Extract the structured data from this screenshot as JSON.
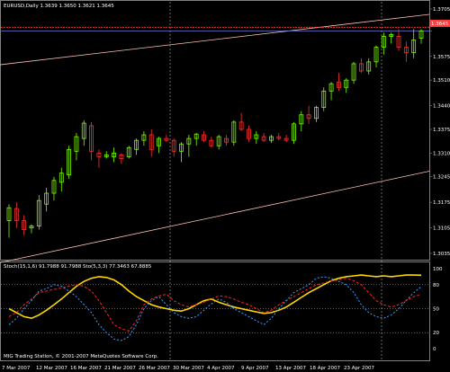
{
  "main_header": "EURUSD,Daily  1.3639 1.3650 1.3621 1.3645",
  "stoch_header": "Stoch(15,1,6) 91.7988 91.7988  Sto(5,3,3) 77.3463 67.8885",
  "copyright": "MIG Trading Station, © 2001-2007 MetaQuotes Software Corp.",
  "price_badge": "1.3645",
  "price_ticks": [
    "1.3705",
    "1.3645",
    "1.3575",
    "1.3510",
    "1.3440",
    "1.3375",
    "1.3310",
    "1.3245",
    "1.3175",
    "1.3105",
    "1.3035"
  ],
  "stoch_ticks": [
    "100",
    "80",
    "50",
    "20",
    "0"
  ],
  "date_labels": [
    "7 Mar 2007",
    "12 Mar 2007",
    "16 Mar 2007",
    "21 Mar 2007",
    "26 Mar 2007",
    "30 Mar 2007",
    "4 Apr 2007",
    "9 Apr 2007",
    "13 Apr 2007",
    "18 Apr 2007",
    "23 Apr 2007"
  ],
  "colors": {
    "background": "#000000",
    "bull": "#7cfc00",
    "bear": "#ff3030",
    "stoch_main": "#ffd700",
    "sto_signal": "#ff2222",
    "sto_main": "#3aa0ff",
    "trendline": "#ffc0b4",
    "price_badge": "#ff3b3b"
  },
  "chart_data": [
    {
      "type": "candlestick",
      "series": [
        {
          "name": "EURUSD,Daily"
        }
      ],
      "ylim": [
        1.3035,
        1.3705
      ],
      "candles": [
        {
          "o": 1.3125,
          "h": 1.317,
          "l": 1.3078,
          "c": 1.316
        },
        {
          "o": 1.3158,
          "h": 1.3175,
          "l": 1.3105,
          "c": 1.3125
        },
        {
          "o": 1.3125,
          "h": 1.314,
          "l": 1.3085,
          "c": 1.31
        },
        {
          "o": 1.3105,
          "h": 1.3115,
          "l": 1.309,
          "c": 1.311
        },
        {
          "o": 1.311,
          "h": 1.3195,
          "l": 1.31,
          "c": 1.318
        },
        {
          "o": 1.317,
          "h": 1.3215,
          "l": 1.315,
          "c": 1.32
        },
        {
          "o": 1.32,
          "h": 1.3245,
          "l": 1.318,
          "c": 1.3235
        },
        {
          "o": 1.323,
          "h": 1.327,
          "l": 1.3205,
          "c": 1.3255
        },
        {
          "o": 1.325,
          "h": 1.333,
          "l": 1.324,
          "c": 1.332
        },
        {
          "o": 1.3315,
          "h": 1.3365,
          "l": 1.329,
          "c": 1.3355
        },
        {
          "o": 1.335,
          "h": 1.34,
          "l": 1.333,
          "c": 1.3392
        },
        {
          "o": 1.3385,
          "h": 1.3395,
          "l": 1.329,
          "c": 1.3315
        },
        {
          "o": 1.331,
          "h": 1.332,
          "l": 1.327,
          "c": 1.33
        },
        {
          "o": 1.33,
          "h": 1.3315,
          "l": 1.3295,
          "c": 1.3305
        },
        {
          "o": 1.33,
          "h": 1.3325,
          "l": 1.3285,
          "c": 1.331
        },
        {
          "o": 1.3305,
          "h": 1.331,
          "l": 1.328,
          "c": 1.3295
        },
        {
          "o": 1.33,
          "h": 1.333,
          "l": 1.3295,
          "c": 1.3325
        },
        {
          "o": 1.332,
          "h": 1.335,
          "l": 1.3305,
          "c": 1.3345
        },
        {
          "o": 1.3345,
          "h": 1.337,
          "l": 1.333,
          "c": 1.336
        },
        {
          "o": 1.336,
          "h": 1.3375,
          "l": 1.33,
          "c": 1.332
        },
        {
          "o": 1.333,
          "h": 1.3355,
          "l": 1.331,
          "c": 1.335
        },
        {
          "o": 1.335,
          "h": 1.336,
          "l": 1.334,
          "c": 1.3345
        },
        {
          "o": 1.3345,
          "h": 1.335,
          "l": 1.33,
          "c": 1.3315
        },
        {
          "o": 1.3315,
          "h": 1.334,
          "l": 1.3285,
          "c": 1.3335
        },
        {
          "o": 1.3335,
          "h": 1.336,
          "l": 1.33,
          "c": 1.335
        },
        {
          "o": 1.335,
          "h": 1.3365,
          "l": 1.333,
          "c": 1.3362
        },
        {
          "o": 1.336,
          "h": 1.337,
          "l": 1.334,
          "c": 1.3345
        },
        {
          "o": 1.3345,
          "h": 1.3355,
          "l": 1.3325,
          "c": 1.333
        },
        {
          "o": 1.333,
          "h": 1.336,
          "l": 1.332,
          "c": 1.3355
        },
        {
          "o": 1.335,
          "h": 1.336,
          "l": 1.333,
          "c": 1.334
        },
        {
          "o": 1.334,
          "h": 1.34,
          "l": 1.333,
          "c": 1.3395
        },
        {
          "o": 1.3395,
          "h": 1.342,
          "l": 1.337,
          "c": 1.3375
        },
        {
          "o": 1.3375,
          "h": 1.3385,
          "l": 1.334,
          "c": 1.335
        },
        {
          "o": 1.335,
          "h": 1.337,
          "l": 1.3335,
          "c": 1.336
        },
        {
          "o": 1.3355,
          "h": 1.3365,
          "l": 1.334,
          "c": 1.3345
        },
        {
          "o": 1.3345,
          "h": 1.336,
          "l": 1.3338,
          "c": 1.3355
        },
        {
          "o": 1.3355,
          "h": 1.3365,
          "l": 1.3345,
          "c": 1.335
        },
        {
          "o": 1.335,
          "h": 1.336,
          "l": 1.334,
          "c": 1.3345
        },
        {
          "o": 1.3345,
          "h": 1.3395,
          "l": 1.3335,
          "c": 1.339
        },
        {
          "o": 1.339,
          "h": 1.3425,
          "l": 1.337,
          "c": 1.3415
        },
        {
          "o": 1.3415,
          "h": 1.344,
          "l": 1.339,
          "c": 1.3405
        },
        {
          "o": 1.3405,
          "h": 1.344,
          "l": 1.3395,
          "c": 1.3435
        },
        {
          "o": 1.3435,
          "h": 1.349,
          "l": 1.3425,
          "c": 1.348
        },
        {
          "o": 1.348,
          "h": 1.3505,
          "l": 1.3455,
          "c": 1.35
        },
        {
          "o": 1.3505,
          "h": 1.353,
          "l": 1.348,
          "c": 1.349
        },
        {
          "o": 1.349,
          "h": 1.3515,
          "l": 1.3475,
          "c": 1.351
        },
        {
          "o": 1.351,
          "h": 1.356,
          "l": 1.35,
          "c": 1.3555
        },
        {
          "o": 1.3555,
          "h": 1.357,
          "l": 1.353,
          "c": 1.3535
        },
        {
          "o": 1.3535,
          "h": 1.357,
          "l": 1.3525,
          "c": 1.356
        },
        {
          "o": 1.356,
          "h": 1.3605,
          "l": 1.3545,
          "c": 1.36
        },
        {
          "o": 1.36,
          "h": 1.364,
          "l": 1.358,
          "c": 1.363
        },
        {
          "o": 1.363,
          "h": 1.364,
          "l": 1.361,
          "c": 1.3635
        },
        {
          "o": 1.363,
          "h": 1.365,
          "l": 1.359,
          "c": 1.36
        },
        {
          "o": 1.36,
          "h": 1.3615,
          "l": 1.356,
          "c": 1.3585
        },
        {
          "o": 1.3585,
          "h": 1.365,
          "l": 1.357,
          "c": 1.362
        },
        {
          "o": 1.3625,
          "h": 1.365,
          "l": 1.361,
          "c": 1.3645
        }
      ],
      "horizontal_lines": [
        1.3645,
        1.3655
      ],
      "trendlines": [
        {
          "start": [
            0,
            1.3555
          ],
          "end": [
            56,
            1.369
          ]
        },
        {
          "start": [
            0,
            1.3015
          ],
          "end": [
            56,
            1.326
          ]
        }
      ],
      "grid": false
    },
    {
      "type": "line",
      "ylim": [
        0,
        100
      ],
      "levels": [
        80,
        50,
        20
      ],
      "series": [
        {
          "name": "Stoch(15,1,6)",
          "values": [
            50,
            45,
            40,
            38,
            42,
            48,
            55,
            62,
            70,
            78,
            84,
            88,
            90,
            89,
            86,
            80,
            72,
            65,
            60,
            55,
            52,
            50,
            48,
            47,
            50,
            55,
            60,
            62,
            58,
            55,
            52,
            50,
            48,
            46,
            44,
            45,
            48,
            52,
            58,
            64,
            70,
            75,
            80,
            85,
            88,
            90,
            91,
            92,
            91,
            90,
            91,
            90,
            91,
            92,
            92,
            91.8
          ]
        },
        {
          "name": "Sto(5,3,3)",
          "values": [
            40,
            45,
            55,
            62,
            70,
            72,
            74,
            76,
            78,
            80,
            78,
            72,
            60,
            45,
            30,
            25,
            22,
            35,
            55,
            62,
            66,
            68,
            60,
            55,
            52,
            55,
            58,
            62,
            66,
            65,
            62,
            58,
            55,
            50,
            45,
            48,
            55,
            60,
            65,
            70,
            75,
            80,
            82,
            85,
            86,
            88,
            85,
            80,
            70,
            60,
            55,
            52,
            55,
            60,
            65,
            67.9
          ]
        },
        {
          "name": "",
          "values": [
            30,
            38,
            50,
            60,
            72,
            75,
            80,
            78,
            72,
            65,
            55,
            45,
            30,
            20,
            12,
            10,
            15,
            30,
            50,
            60,
            65,
            55,
            45,
            40,
            38,
            40,
            48,
            56,
            62,
            58,
            50,
            45,
            40,
            35,
            30,
            38,
            50,
            60,
            70,
            75,
            80,
            88,
            90,
            88,
            84,
            80,
            70,
            55,
            45,
            40,
            38,
            42,
            50,
            60,
            70,
            77.3
          ]
        }
      ]
    }
  ]
}
